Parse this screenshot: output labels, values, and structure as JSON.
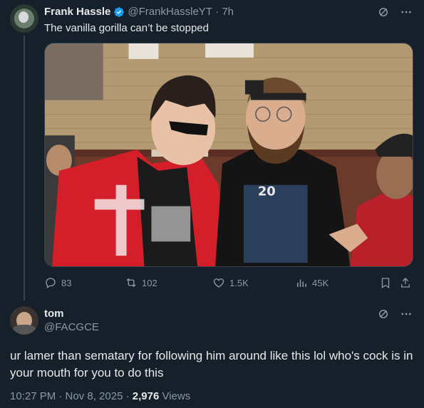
{
  "tweet1": {
    "author_name": "Frank Hassle",
    "author_handle": "@FrankHassleYT",
    "time_ago": "7h",
    "text": "The vanilla gorilla can’t be stopped",
    "media_icon": "photo",
    "stats": {
      "replies": "83",
      "reposts": "102",
      "likes": "1.5K",
      "views": "45K"
    }
  },
  "tweet2": {
    "author_name": "tom",
    "author_handle": "@FACGCE",
    "text": "ur lamer than sematary for following him around like this lol who's cock is in your mouth for you to do this",
    "time": "10:27 PM · Nov 8, 2025 ·",
    "views_count": "2,976",
    "views_label": "Views"
  },
  "colors": {
    "background": "#15202b",
    "text": "#e7e9ea",
    "muted": "#8b98a5",
    "verified": "#1d9bf0"
  }
}
